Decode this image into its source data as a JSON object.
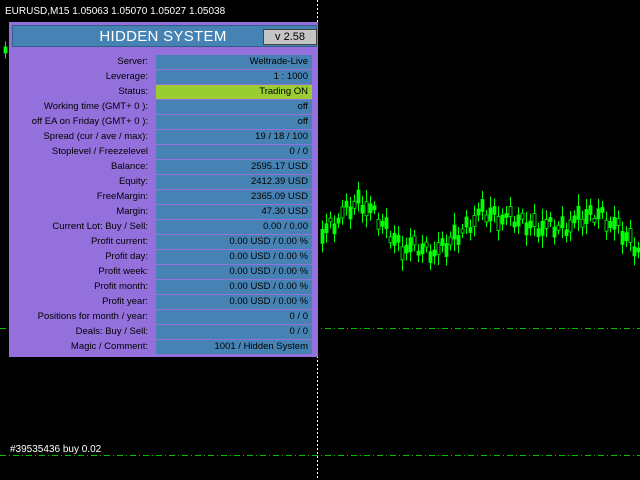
{
  "chart": {
    "header": "EURUSD,M15  1.05063 1.05070 1.05027 1.05038",
    "order_label": "#39535436 buy 0.02",
    "candle_color": "#00ff00",
    "level_color": "#00c000"
  },
  "panel": {
    "title": "HIDDEN SYSTEM",
    "version": "v 2.58",
    "bg_color": "#9370DB",
    "field_color": "#4683B4",
    "status_color": "#9ACD32",
    "rows": [
      {
        "label": "Server:",
        "value": "Weltrade-Live"
      },
      {
        "label": "Leverage:",
        "value": "1 : 1000"
      },
      {
        "label": "Status:",
        "value": "Trading ON"
      },
      {
        "label": "Working time (GMT+ 0 ):",
        "value": "off"
      },
      {
        "label": "off EA on Friday (GMT+ 0 ):",
        "value": "off"
      },
      {
        "label": "Spread (cur / ave / max):",
        "value": "19 / 18 / 100"
      },
      {
        "label": "Stoplevel / Freezelevel",
        "value": "0 / 0"
      },
      {
        "label": "Balance:",
        "value": "2595.17 USD"
      },
      {
        "label": "Equity:",
        "value": "2412.39 USD"
      },
      {
        "label": "FreeMargin:",
        "value": "2365.09 USD"
      },
      {
        "label": "Margin:",
        "value": "47.30 USD"
      },
      {
        "label": "Current Lot:  Buy  /  Sell:",
        "value": "0.00  /  0.00"
      },
      {
        "label": "Profit current:",
        "value": "0.00 USD / 0.00 %"
      },
      {
        "label": "Profit day:",
        "value": "0.00 USD / 0.00 %"
      },
      {
        "label": "Profit week:",
        "value": "0.00 USD / 0.00 %"
      },
      {
        "label": "Profit month:",
        "value": "0.00 USD / 0.00 %"
      },
      {
        "label": "Profit year:",
        "value": "0.00 USD / 0.00 %"
      },
      {
        "label": "Positions for month / year:",
        "value": "0  /  0"
      },
      {
        "label": "Deals: Buy / Sell:",
        "value": "0  /  0"
      },
      {
        "label": "Magic / Comment:",
        "value": "1001 / Hidden System"
      }
    ]
  }
}
